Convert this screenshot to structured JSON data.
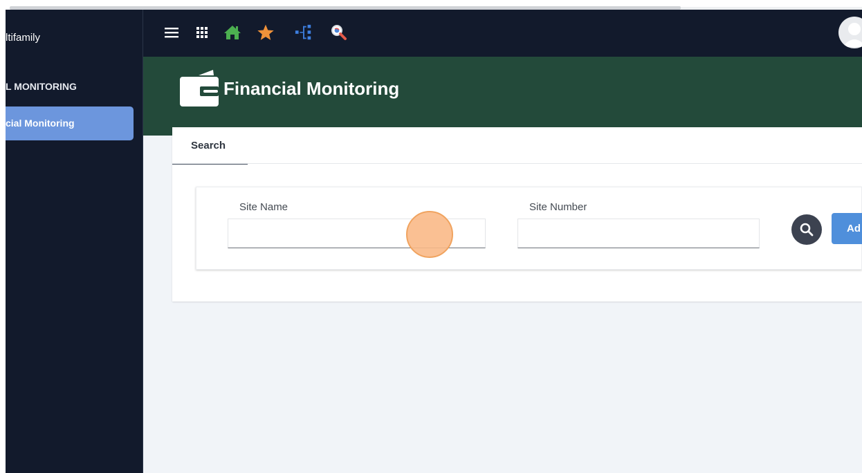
{
  "sidebar": {
    "app_name": "ltifamily",
    "section_label": "L MONITORING",
    "active_item_label": "cial Monitoring"
  },
  "topbar": {
    "icons": [
      "menu-icon",
      "apps-grid-icon",
      "home-icon",
      "star-icon",
      "sitemap-icon",
      "search-globe-icon"
    ],
    "avatar": "user-avatar"
  },
  "header": {
    "title": "Financial Monitoring",
    "icon": "wallet-icon"
  },
  "tabs": [
    {
      "label": "Search",
      "active": true
    }
  ],
  "form": {
    "site_name": {
      "label": "Site Name",
      "value": "",
      "placeholder": ""
    },
    "site_number": {
      "label": "Site Number",
      "value": "",
      "placeholder": ""
    },
    "search_button_icon": "search-icon",
    "add_button_label": "Ad"
  },
  "colors": {
    "sidebar_bg": "#121a2c",
    "header_bg": "#234a3a",
    "active_item": "#6c96dd",
    "add_button": "#4f8fdb",
    "home_icon": "#4caf50",
    "star_icon": "#f0923a",
    "sitemap_icon": "#3d7fe0"
  }
}
